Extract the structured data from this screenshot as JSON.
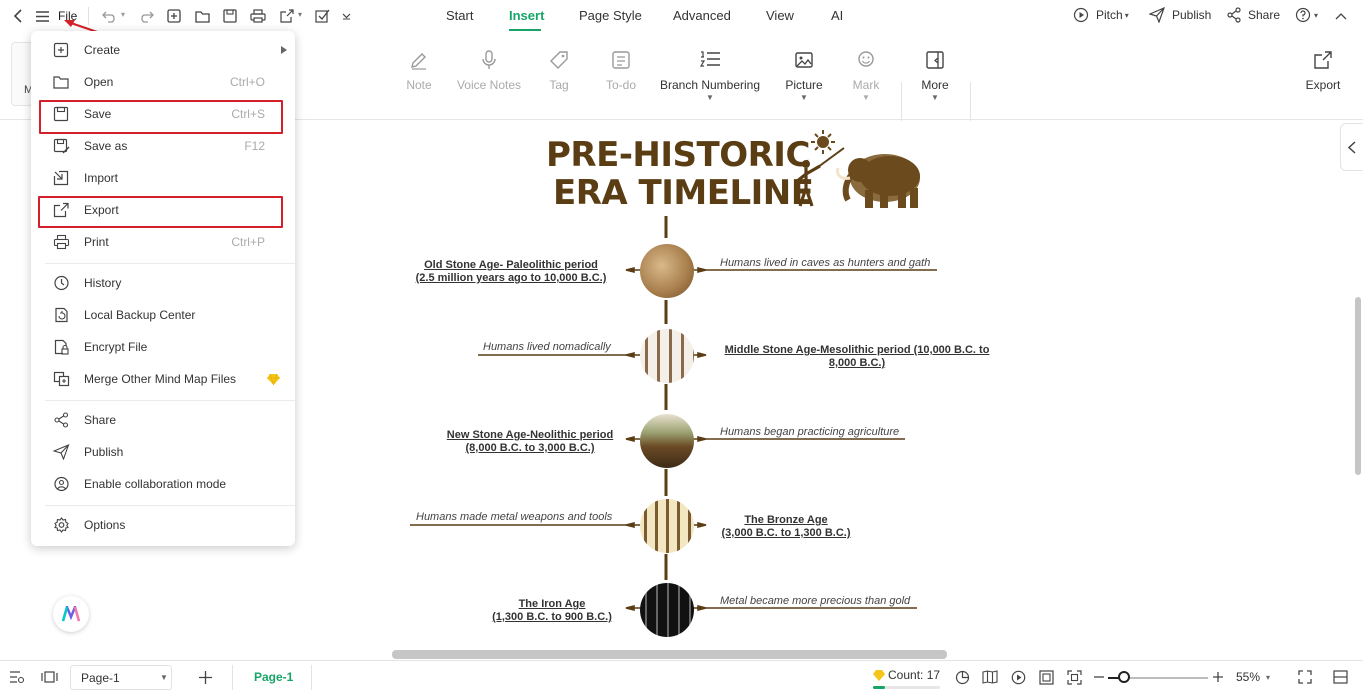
{
  "topbar": {
    "file_label": "File",
    "tabs": [
      {
        "label": "Start",
        "active": false
      },
      {
        "label": "Insert",
        "active": true
      },
      {
        "label": "Page Style",
        "active": false
      },
      {
        "label": "Advanced",
        "active": false
      },
      {
        "label": "View",
        "active": false
      },
      {
        "label": "AI",
        "active": false
      }
    ],
    "pitch_label": "Pitch",
    "publish_label": "Publish",
    "share_label": "Share"
  },
  "ribbon": {
    "tools": [
      {
        "label": "Note",
        "icon": "note-icon",
        "enabled": false
      },
      {
        "label": "Voice Notes",
        "icon": "microphone-icon",
        "enabled": false
      },
      {
        "label": "Tag",
        "icon": "tag-icon",
        "enabled": false
      },
      {
        "label": "To-do",
        "icon": "todo-icon",
        "enabled": false
      },
      {
        "label": "Branch Numbering",
        "icon": "numbered-list-icon",
        "enabled": true
      },
      {
        "label": "Picture",
        "icon": "picture-icon",
        "enabled": true
      },
      {
        "label": "Mark",
        "icon": "mark-icon",
        "enabled": false
      },
      {
        "label": "More",
        "icon": "more-icon",
        "enabled": true
      }
    ],
    "export_label": "Export",
    "left_stub_label": "M"
  },
  "file_menu": {
    "items": [
      {
        "label": "Create",
        "shortcut": "",
        "icon": "plus-square-icon",
        "submenu": true
      },
      {
        "label": "Open",
        "shortcut": "Ctrl+O",
        "icon": "folder-icon"
      },
      {
        "label": "Save",
        "shortcut": "Ctrl+S",
        "icon": "save-icon",
        "highlighted": true
      },
      {
        "label": "Save as",
        "shortcut": "F12",
        "icon": "save-as-icon"
      },
      {
        "label": "Import",
        "shortcut": "",
        "icon": "import-icon"
      },
      {
        "label": "Export",
        "shortcut": "",
        "icon": "export-icon",
        "highlighted": true
      },
      {
        "label": "Print",
        "shortcut": "Ctrl+P",
        "icon": "printer-icon"
      },
      {
        "label": "History",
        "shortcut": "",
        "icon": "clock-icon"
      },
      {
        "label": "Local Backup Center",
        "shortcut": "",
        "icon": "backup-icon"
      },
      {
        "label": "Encrypt File",
        "shortcut": "",
        "icon": "lock-file-icon"
      },
      {
        "label": "Merge Other Mind Map Files",
        "shortcut": "",
        "icon": "merge-icon",
        "premium": true
      },
      {
        "label": "Share",
        "shortcut": "",
        "icon": "share-icon"
      },
      {
        "label": "Publish",
        "shortcut": "",
        "icon": "send-icon"
      },
      {
        "label": "Enable collaboration mode",
        "shortcut": "",
        "icon": "collaboration-icon"
      },
      {
        "label": "Options",
        "shortcut": "",
        "icon": "gear-icon"
      }
    ]
  },
  "mindmap": {
    "title_line1": "PRE-HISTORIC",
    "title_line2": "ERA TIMELINE",
    "eras": [
      {
        "name_line1": "Old Stone Age- Paleolithic period",
        "name_line2": "(2.5 million years ago to 10,000 B.C.)",
        "description": "Humans lived in caves as hunters and gath"
      },
      {
        "name_line1": "Middle Stone Age-Mesolithic period (10,000 B.C. to",
        "name_line2": "8,000 B.C.)",
        "description": "Humans lived nomadically"
      },
      {
        "name_line1": "New Stone Age-Neolithic period",
        "name_line2": "(8,000 B.C. to 3,000 B.C.)",
        "description": "Humans began practicing agriculture"
      },
      {
        "name_line1": "The Bronze Age",
        "name_line2": "(3,000 B.C. to 1,300 B.C.)",
        "description": "Humans made metal weapons and tools"
      },
      {
        "name_line1": "The Iron Age",
        "name_line2": "(1,300 B.C. to 900 B.C.)",
        "description": "Metal became more precious than gold"
      }
    ]
  },
  "bottombar": {
    "page_select": "Page-1",
    "page_tab": "Page-1",
    "count_label": "Count: 17",
    "zoom_label": "55%"
  },
  "colors": {
    "accent": "#17a567",
    "highlight": "#d4202a",
    "timeline_brown": "#5b3d14"
  }
}
